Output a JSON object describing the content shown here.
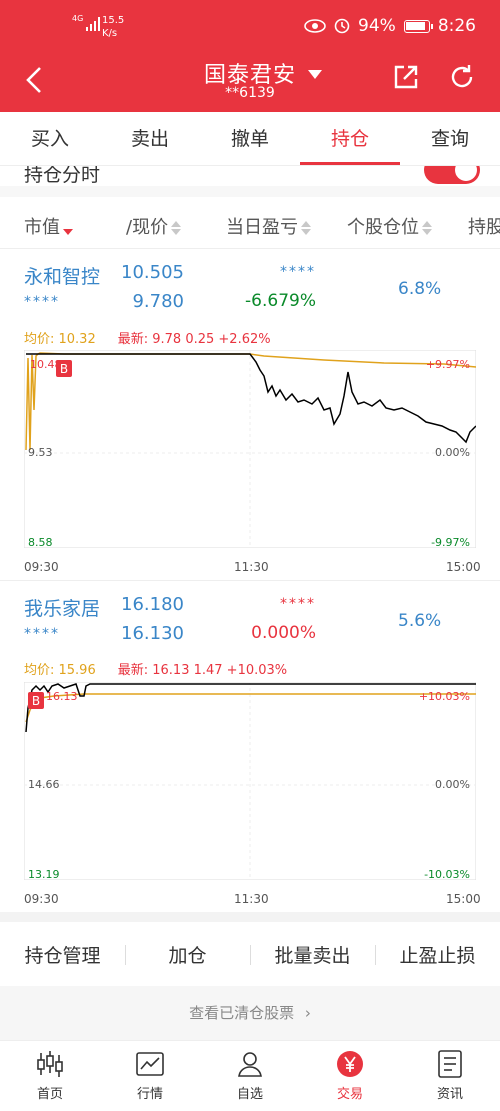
{
  "status_bar": {
    "network": "4G",
    "speed": "15.5",
    "speed_unit": "K/s",
    "battery": "94%",
    "time": "8:26"
  },
  "header": {
    "title": "国泰君安",
    "account": "**6139",
    "icons": [
      "back-icon",
      "dropdown-caret-icon",
      "share-icon",
      "refresh-icon"
    ]
  },
  "tabs": [
    {
      "label": "买入",
      "active": false
    },
    {
      "label": "卖出",
      "active": false
    },
    {
      "label": "撤单",
      "active": false
    },
    {
      "label": "持仓",
      "active": true
    },
    {
      "label": "查询",
      "active": false
    }
  ],
  "toggle": {
    "label": "持仓分时",
    "on": true
  },
  "columns": [
    "市值",
    "/现价",
    "当日盈亏",
    "个股仓位",
    "持股"
  ],
  "holdings": [
    {
      "name": "永和智控",
      "market_value": "****",
      "cost": "10.505",
      "price": "9.780",
      "pnl_value": "****",
      "pnl_pct": "-6.679%",
      "position_pct": "6.8%",
      "avg_label": "均价: 10.32",
      "latest_label": "最新: 9.78  0.25  +2.62%",
      "chart": {
        "y_top": "10.48",
        "y_mid": "9.53",
        "y_bot": "8.58",
        "pct_top": "+9.97%",
        "pct_mid": "0.00%",
        "pct_bot": "-9.97%",
        "x_labels": [
          "09:30",
          "11:30",
          "15:00"
        ],
        "marker": "B"
      }
    },
    {
      "name": "我乐家居",
      "market_value": "****",
      "cost": "16.180",
      "price": "16.130",
      "pnl_value": "****",
      "pnl_pct": "0.000%",
      "position_pct": "5.6%",
      "avg_label": "均价: 15.96",
      "latest_label": "最新: 16.13  1.47  +10.03%",
      "chart": {
        "y_top": "16.13",
        "y_mid": "14.66",
        "y_bot": "13.19",
        "pct_top": "+10.03%",
        "pct_mid": "0.00%",
        "pct_bot": "-10.03%",
        "x_labels": [
          "09:30",
          "11:30",
          "15:00"
        ],
        "marker": "B"
      }
    }
  ],
  "actions": [
    "持仓管理",
    "加仓",
    "批量卖出",
    "止盈止损"
  ],
  "cleared_link": "查看已清仓股票",
  "bottom_nav": [
    {
      "label": "首页",
      "icon": "candlestick-icon",
      "active": false
    },
    {
      "label": "行情",
      "icon": "market-chart-icon",
      "active": false
    },
    {
      "label": "自选",
      "icon": "user-icon",
      "active": false
    },
    {
      "label": "交易",
      "icon": "yuan-icon",
      "active": true
    },
    {
      "label": "资讯",
      "icon": "news-icon",
      "active": false
    }
  ],
  "colors": {
    "brand_red": "#e8343f",
    "up_red": "#e8343f",
    "down_green": "#0a8a2a",
    "link_blue": "#3a86c8",
    "avg_orange": "#e0a21c"
  }
}
